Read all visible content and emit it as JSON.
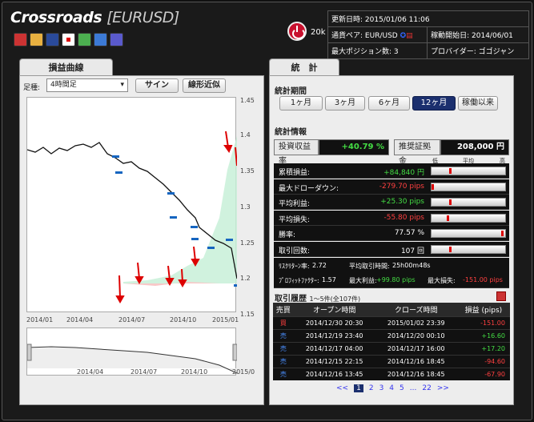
{
  "header": {
    "app_title": "Crossroads",
    "pair": "[EURUSD]",
    "power_count": "20k",
    "updated_label": "更新日時:",
    "updated_value": "2015/01/06 11:06",
    "pair_label": "通貨ペア:",
    "pair_value": "EUR/USD",
    "start_label": "稼動開始日:",
    "start_value": "2014/06/01",
    "maxpos_label": "最大ポジション数:",
    "maxpos_value": "3",
    "provider_label": "プロバイダー:",
    "provider_value": "ゴゴジャン",
    "icons": [
      "trophy-icon",
      "ranking-icon",
      "top100-icon",
      "japan-flag-icon",
      "puzzle-icon",
      "bubble-icon",
      "globe-icon"
    ]
  },
  "left": {
    "tab": "損益曲線",
    "footer_label": "足種:",
    "footer_value": "4時間足",
    "sign_button": "サイン",
    "linear_button": "線形近似",
    "y_ticks": [
      "1.45",
      "1.4",
      "1.35",
      "1.3",
      "1.25",
      "1.2",
      "1.15"
    ],
    "x_ticks": [
      "2014/01",
      "2014/04",
      "2014/07",
      "2014/10",
      "2015/01"
    ],
    "nav_ticks": [
      "2014/04",
      "2014/07",
      "2014/10",
      "2015/0"
    ]
  },
  "right": {
    "tab": "統　計",
    "period_title": "統計期間",
    "periods": [
      "1ヶ月",
      "3ヶ月",
      "6ヶ月",
      "12ヶ月",
      "稼働以来"
    ],
    "selected_period": "12ヶ月",
    "stats_title": "統計情報",
    "roi_label": "投資収益率",
    "roi_value": "+40.79 %",
    "margin_label": "推奨証拠金",
    "margin_value": "208,000 円",
    "scale_low": "低",
    "scale_avg": "平均",
    "scale_high": "高",
    "rows": [
      {
        "label": "累積損益:",
        "value": "+84,840 円",
        "color": "#44dd44",
        "marker": 0.25
      },
      {
        "label": "最大ドローダウン:",
        "value": "-279.70 pips",
        "color": "#ff4040",
        "marker": 0.0
      },
      {
        "label": "平均利益:",
        "value": "+25.30 pips",
        "color": "#44dd44",
        "marker": 0.25
      },
      {
        "label": "平均損失:",
        "value": "-55.80 pips",
        "color": "#ff4040",
        "marker": 0.22
      },
      {
        "label": "勝率:",
        "value": "77.57 %",
        "color": "#ffffff",
        "marker": 0.99
      },
      {
        "label": "取引回数:",
        "value": "107 回",
        "color": "#ffffff",
        "marker": 0.25
      }
    ],
    "extra1_label": "ﾘｽｸﾘﾀｰﾝ率:",
    "extra1_value": "2.72",
    "extra2_label": "平均取引時間:",
    "extra2_value": "25h00m48s",
    "extra3_label": "ﾌﾟﾛﾌｨｯﾄﾌｧｸﾀｰ:",
    "extra3_value": "1.57",
    "extra4_label": "最大利益:",
    "extra4_value": "+99.80 pips",
    "extra5_label": "最大損失:",
    "extra5_value": "-151.00 pips",
    "history_title": "取引履歴",
    "history_count": "1〜5件(全107件)",
    "columns": [
      "売買",
      "オープン時間",
      "クローズ時間",
      "損益 (pips)"
    ],
    "trades": [
      {
        "side": "買",
        "open": "2014/12/30 20:30",
        "close": "2015/01/02 23:39",
        "pnl": "-151.00"
      },
      {
        "side": "売",
        "open": "2014/12/19 23:40",
        "close": "2014/12/20 00:10",
        "pnl": "+16.60"
      },
      {
        "side": "売",
        "open": "2014/12/17 04:00",
        "close": "2014/12/17 16:00",
        "pnl": "+17.20"
      },
      {
        "side": "売",
        "open": "2014/12/15 22:15",
        "close": "2014/12/16 18:45",
        "pnl": "-94.60"
      },
      {
        "side": "売",
        "open": "2014/12/16 13:45",
        "close": "2014/12/16 18:45",
        "pnl": "-67.90"
      }
    ],
    "pager": [
      "<<",
      "1",
      "2",
      "3",
      "4",
      "5",
      "...",
      "22",
      ">>"
    ],
    "pager_current": "1"
  }
}
